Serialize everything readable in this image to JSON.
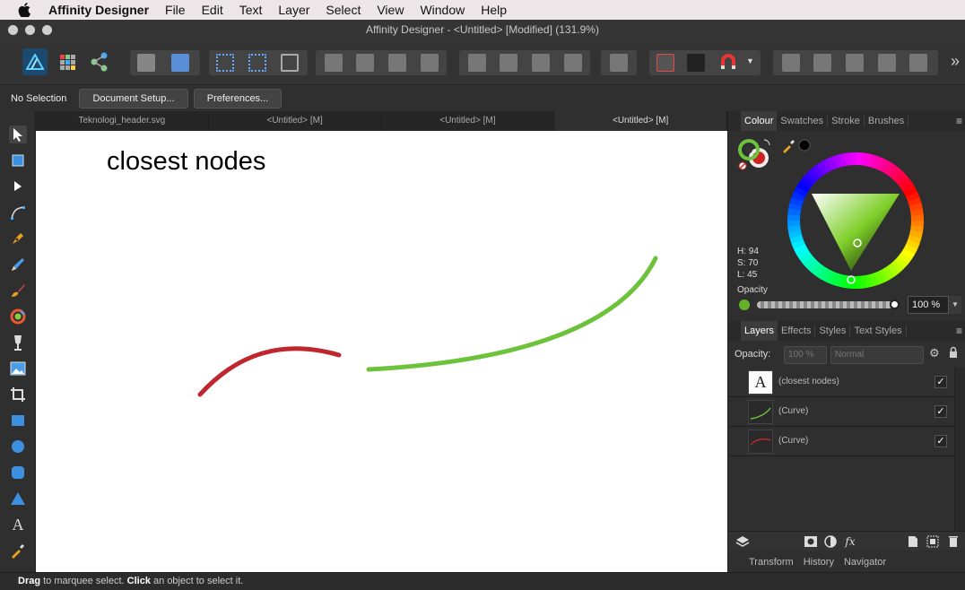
{
  "menubar": {
    "app_name": "Affinity Designer",
    "items": [
      "File",
      "Edit",
      "Text",
      "Layer",
      "Select",
      "View",
      "Window",
      "Help"
    ]
  },
  "window": {
    "title": "Affinity Designer - <Untitled> [Modified] (131.9%)"
  },
  "context": {
    "selection": "No Selection",
    "document_setup": "Document Setup...",
    "preferences": "Preferences..."
  },
  "doc_tabs": [
    "Teknologi_header.svg",
    "<Untitled> [M]",
    "<Untitled> [M]",
    "<Untitled> [M]"
  ],
  "canvas": {
    "text": "closest nodes",
    "curve_colors": {
      "red": "#c0262e",
      "green": "#6cc23a"
    }
  },
  "colour_panel": {
    "tabs": [
      "Colour",
      "Swatches",
      "Stroke",
      "Brushes"
    ],
    "h": "H: 94",
    "s": "S: 70",
    "l": "L: 45",
    "opacity_label": "Opacity",
    "opacity_value": "100 %",
    "fill_color": "#63b22a"
  },
  "layers_panel": {
    "tabs": [
      "Layers",
      "Effects",
      "Styles",
      "Text Styles"
    ],
    "opacity_label": "Opacity:",
    "opacity_value": "100 %",
    "blend_mode": "Normal",
    "rows": [
      {
        "name": "(closest nodes)",
        "type": "text"
      },
      {
        "name": "(Curve)",
        "type": "curve-green"
      },
      {
        "name": "(Curve)",
        "type": "curve-red"
      }
    ]
  },
  "bottom_tabs": [
    "Transform",
    "History",
    "Navigator"
  ],
  "status": {
    "drag": "Drag",
    "drag_rest": " to marquee select. ",
    "click": "Click",
    "click_rest": " an object to select it."
  }
}
